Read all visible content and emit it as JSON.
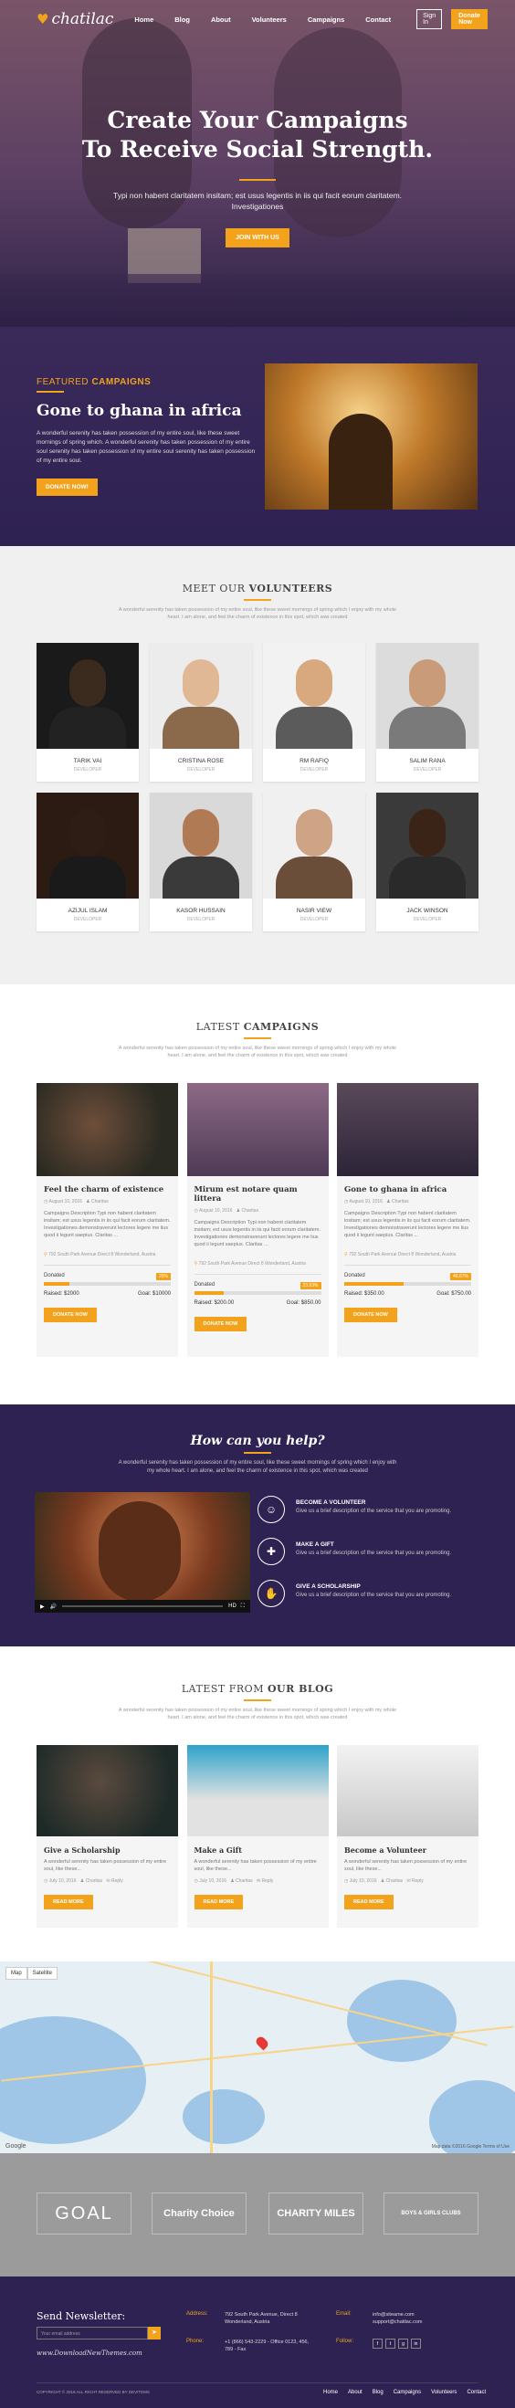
{
  "nav": {
    "logo": "chatilac",
    "items": [
      "Home",
      "Blog",
      "About",
      "Volunteers",
      "Campaigns",
      "Contact"
    ],
    "signin": "Sign In",
    "donate": "Donate Now"
  },
  "hero": {
    "title_line1": "Create Your Campaigns",
    "title_line2": "To Receive Social Strength.",
    "subtitle": "Typi non habent claritatem insitam; est usus legentis in iis qui facit eorum claritatem. Investigationes",
    "button": "JOIN WITH US"
  },
  "featured": {
    "label_a": "FEATURED",
    "label_b": "CAMPAIGNS",
    "title": "Gone to ghana in africa",
    "text": "A wonderful serenity has taken possession of my entire soul, like these sweet mornings of spring which. A wonderful serenity has taken possession of my entire soul serenity has taken possession of my entire soul serenity has taken possession of my entire soul.",
    "button": "DONATE NOW!"
  },
  "volunteers": {
    "title_a": "MEET OUR",
    "title_b": "VOLUNTEERS",
    "desc": "A wonderful serenity has taken possession of my entire soul, like these sweet mornings of spring which I enjoy with my whole heart. I am alone, and feel the charm of existence in this spot, which was created",
    "items": [
      {
        "name": "TARIK VAI",
        "role": "DEVELOPER"
      },
      {
        "name": "CRISTINA ROSE",
        "role": "DEVELOPER"
      },
      {
        "name": "RM RAFIQ",
        "role": "DEVELOPER"
      },
      {
        "name": "SALIM RANA",
        "role": "DEVELOPER"
      },
      {
        "name": "AZIJUL ISLAM",
        "role": "DEVELOPER"
      },
      {
        "name": "KASOR HUSSAIN",
        "role": "DEVELOPER"
      },
      {
        "name": "NASIR VIEW",
        "role": "DEVELOPER"
      },
      {
        "name": "JACK WINSON",
        "role": "DEVELOPER"
      }
    ]
  },
  "campaigns": {
    "title_a": "LATEST",
    "title_b": "CAMPAIGNS",
    "desc": "A wonderful serenity has taken possession of my entire soul, like these sweet mornings of spring which I enjoy with my whole heart. I am alone, and feel the charm of existence in this spot, which was created",
    "items": [
      {
        "title": "Feel the charm of existence",
        "date": "August 10, 2016",
        "author": "Charitas",
        "desc": "Campaigns Description Typi non habent claritatem insitam; est usus legentis in iis qui facit eorum claritatem. Investigationes demonstraverunt lectores legere me lius quod ii legunt saepius. Claritas ...",
        "address": "792 South Park Avenue Direct 8 Wonderland, Austria",
        "donated": "Donated",
        "pct": "20%",
        "fill": 0.2,
        "raised": "Raised: $2000",
        "goal": "Goal: $10000"
      },
      {
        "title": "Mirum est notare quam littera",
        "date": "August 10, 2016",
        "author": "Charitas",
        "desc": "Campaigns Description Typi non habent claritatem insitam; est usus legentis in iis qui facit eorum claritatem. Investigationes demonstraverunt lectores legere me lius quod ii legunt saepius. Claritas ...",
        "address": "792 South Park Avenue Direct 8 Wonderland, Austria",
        "donated": "Donated",
        "pct": "23.53%",
        "fill": 0.2353,
        "raised": "Raised: $200.00",
        "goal": "Goal: $850.00"
      },
      {
        "title": "Gone to ghana in africa",
        "date": "August 10, 2016",
        "author": "Charitas",
        "desc": "Campaigns Description Typi non habent claritatem insitam; est usus legentis in iis qui facit eorum claritatem. Investigationes demonstraverunt lectores legere me lius quod ii legunt saepius. Claritas ...",
        "address": "792 South Park Avenue Direct 8 Wonderland, Austria",
        "donated": "Donated",
        "pct": "46.67%",
        "fill": 0.4667,
        "raised": "Raised: $350.00",
        "goal": "Goal: $750.00"
      }
    ],
    "button": "DONATE NOW"
  },
  "help": {
    "title": "How can you help?",
    "desc": "A wonderful serenity has taken possession of my entire soul, like these sweet mornings of spring which I enjoy with my whole heart. I am alone, and feel the charm of existence in this spot, which was created",
    "services": [
      {
        "title": "BECOME A VOLUNTEER",
        "desc": "Give us a brief description of the service that you are promoting."
      },
      {
        "title": "MAKE A GIFT",
        "desc": "Give us a brief description of the service that you are promoting."
      },
      {
        "title": "GIVE A SCHOLARSHIP",
        "desc": "Give us a brief description of the service that you are promoting."
      }
    ],
    "video_hd": "HD"
  },
  "blog": {
    "title_a": "LATEST FROM",
    "title_b": "OUR BLOG",
    "desc": "A wonderful serenity has taken possession of my entire soul, like these sweet mornings of spring which I enjoy with my whole heart. I am alone, and feel the charm of existence in this spot, which was created",
    "items": [
      {
        "title": "Give a Scholarship",
        "desc": "A wonderful serenity has taken possession of my entire soul, like these...",
        "date": "July 10, 2016",
        "author": "Charitas",
        "comments": "Reply"
      },
      {
        "title": "Make a Gift",
        "desc": "A wonderful serenity has taken possession of my entire soul, like these...",
        "date": "July 10, 2016",
        "author": "Charitas",
        "comments": "Reply"
      },
      {
        "title": "Become a Volunteer",
        "desc": "A wonderful serenity has taken possession of my entire soul, like these...",
        "date": "July 10, 2016",
        "author": "Charitas",
        "comments": "Reply"
      }
    ],
    "button": "READ MORE"
  },
  "map": {
    "map_tab": "Map",
    "satellite_tab": "Satellite",
    "google": "Google",
    "copyright": "Map data ©2016 Google   Terms of Use"
  },
  "partners": [
    "GOAL",
    "Charity Choice",
    "CHARITY MILES",
    "BOYS & GIRLS CLUBS"
  ],
  "footer": {
    "newsletter": "Send Newsletter:",
    "input_placeholder": "Your email address",
    "watermark": "www.DownloadNewThemes.com",
    "address_label": "Address:",
    "address": "792 South Park Avenue, Direct 8 Wonderland, Austria",
    "phone_label": "Phone:",
    "phone": "+1 (866) 543-2229 - Office 0123, 456, 789 - Fax",
    "email_label": "Email:",
    "email": "info@siteame.com support@chatilac.com",
    "follow_label": "Follow:",
    "copyright": "COPYRIGHT © 2016 ALL RIGHT RESERVED BY DEVITEMS",
    "menu": [
      "Home",
      "About",
      "Blog",
      "Campaigns",
      "Volunteers",
      "Contact"
    ]
  },
  "colors": {
    "accent": "#f2a21b",
    "purple": "#2d2252"
  }
}
